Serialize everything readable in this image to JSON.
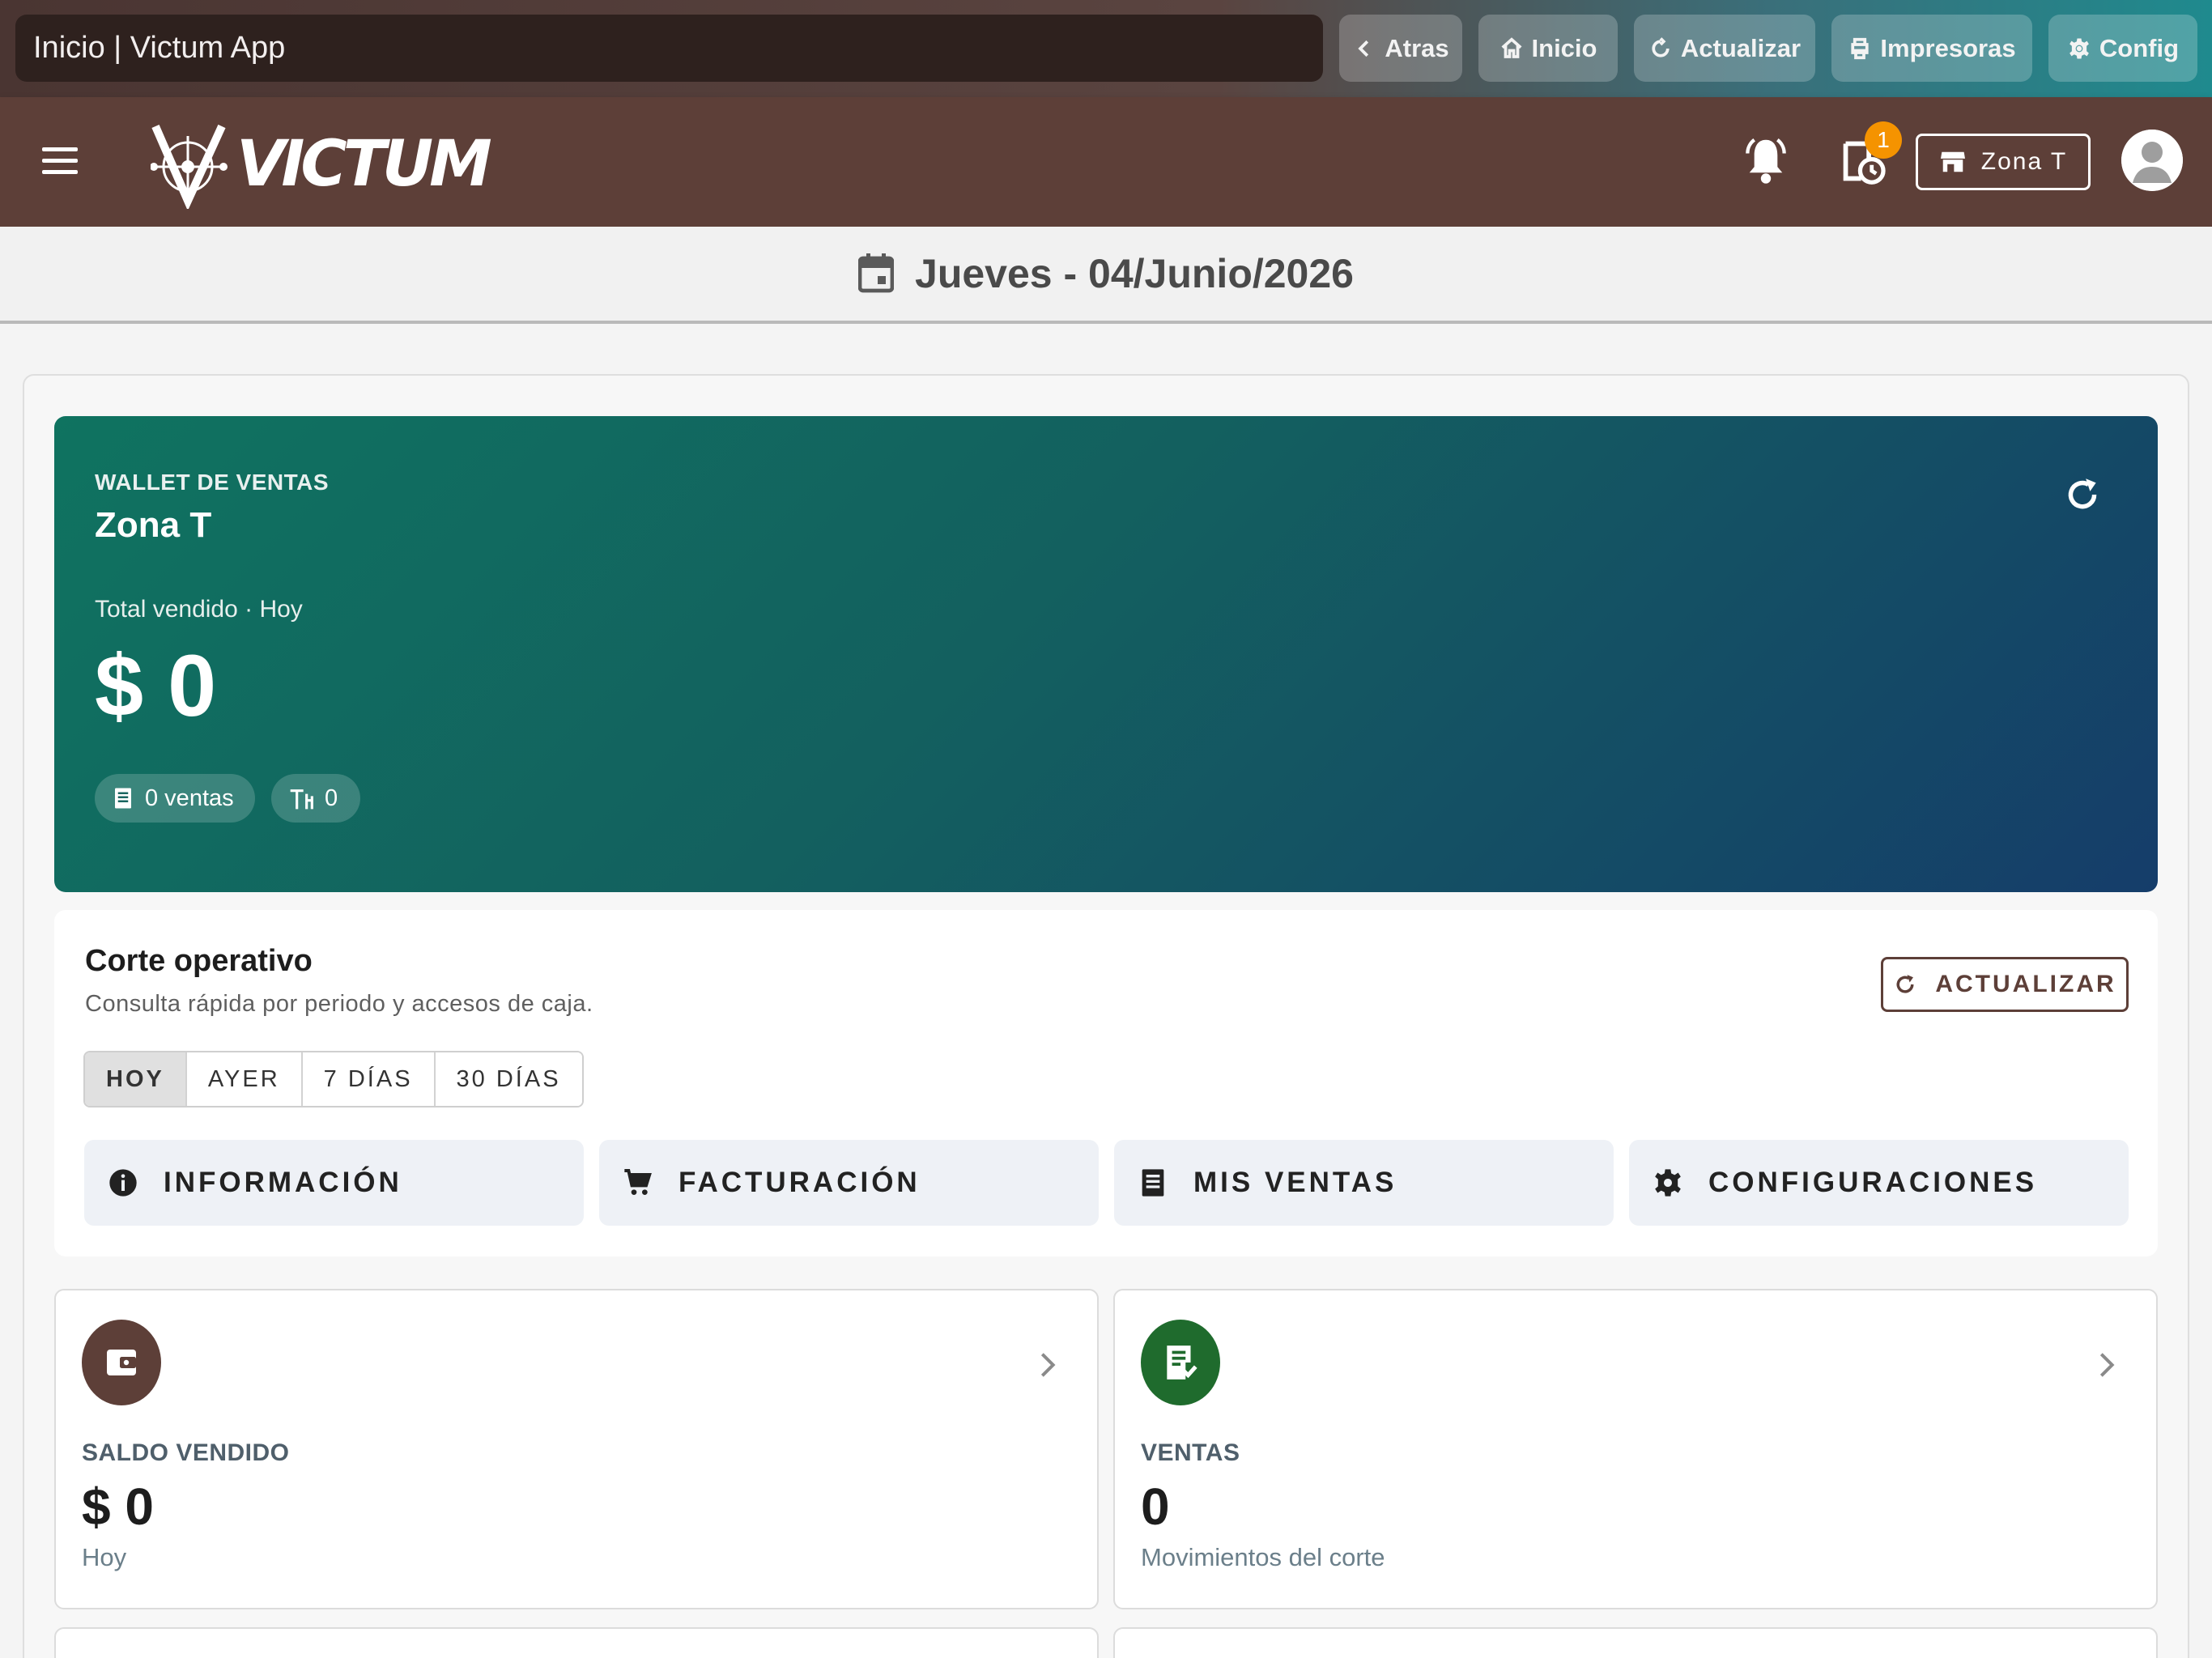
{
  "browser": {
    "title": "Inicio | Victum App",
    "buttons": {
      "back": "Atras",
      "home": "Inicio",
      "refresh": "Actualizar",
      "printers": "Impresoras",
      "config": "Config"
    }
  },
  "header": {
    "logo_text": "VICTUM",
    "notification_badge": "1",
    "zone_button": "Zona T",
    "icons": [
      "menu-icon",
      "bell-icon",
      "history-clock-icon",
      "store-icon",
      "avatar-icon"
    ]
  },
  "date_bar": {
    "date": "Jueves - 04/Junio/2026"
  },
  "wallet": {
    "label": "WALLET DE VENTAS",
    "zone": "Zona T",
    "subtitle": "Total vendido · Hoy",
    "amount": "$ 0",
    "chip_sales": "0 ventas",
    "chip_tables": "0"
  },
  "corte": {
    "title": "Corte operativo",
    "subtitle": "Consulta rápida por periodo y accesos de caja.",
    "refresh_button": "ACTUALIZAR",
    "periods": [
      "HOY",
      "AYER",
      "7 DÍAS",
      "30 DÍAS"
    ],
    "active_period": "HOY",
    "quick_buttons": [
      "INFORMACIÓN",
      "FACTURACIÓN",
      "MIS VENTAS",
      "CONFIGURACIONES"
    ]
  },
  "stats": [
    {
      "label": "SALDO VENDIDO",
      "value": "$ 0",
      "sub": "Hoy",
      "icon": "wallet-icon",
      "color": "#5d3f38"
    },
    {
      "label": "VENTAS",
      "value": "0",
      "sub": "Movimientos del corte",
      "icon": "receipt-check-icon",
      "color": "#1f6b2d"
    }
  ],
  "colors": {
    "brand_brown": "#5d3f38",
    "wallet_start": "#0f7360",
    "wallet_end": "#153d6a",
    "badge_orange": "#f59300"
  }
}
